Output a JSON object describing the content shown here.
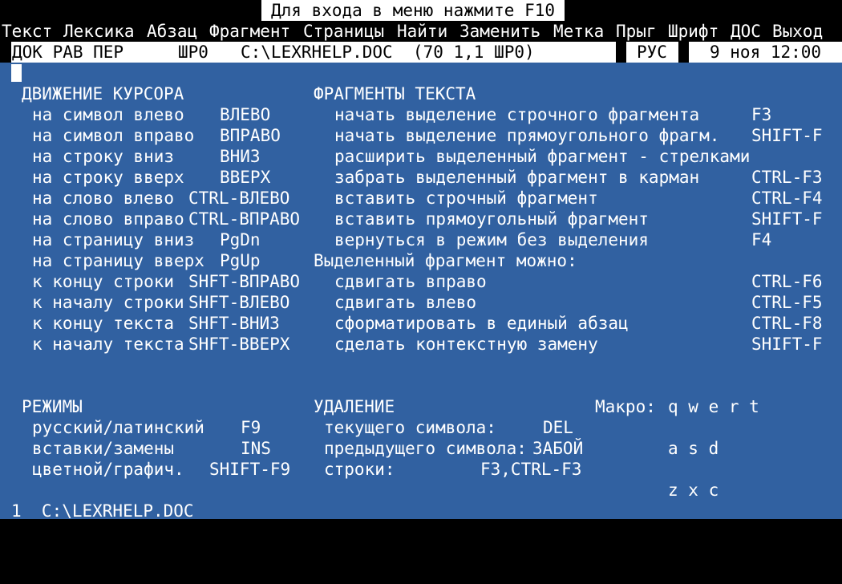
{
  "top_hint": {
    "text": "Для входа в меню нажмите F10"
  },
  "menu": [
    "Текст",
    "Лексика",
    "Абзац",
    "Фрагмент",
    "Страницы",
    "Найти",
    "Заменить",
    "Метка",
    "Прыг",
    "Шрифт",
    "ДОС",
    "Выход"
  ],
  "status": {
    "modes": "ДОК РАВ ПЕР",
    "width_mode": "ШР0",
    "file_info": "C:\\LEXRHELP.DOC  (70 1,1 ШР0)",
    "lang": "РУС",
    "datetime": "9 ноя 12:00"
  },
  "colors": {
    "document_bg": "#3161a1",
    "bar_bg": "#000000",
    "status_bg": "#ffffff"
  },
  "cursor_section": {
    "title": "ДВИЖЕНИЕ КУРСОРА",
    "items": [
      {
        "action": "на символ влево",
        "key": "ВЛЕВО"
      },
      {
        "action": "на символ вправо",
        "key": "ВПРАВО"
      },
      {
        "action": "на строку вниз",
        "key": "ВНИЗ"
      },
      {
        "action": "на строку вверх",
        "key": "ВВЕРХ"
      },
      {
        "action": "на слово влево",
        "key": "CTRL-ВЛЕВО"
      },
      {
        "action": "на слово вправо",
        "key": "CTRL-ВПРАВО"
      },
      {
        "action": "на страницу вниз",
        "key": "PgDn"
      },
      {
        "action": "на страницу вверх",
        "key": "PgUp"
      },
      {
        "action": "к концу строки",
        "key": "SHFT-ВПРАВО"
      },
      {
        "action": "к началу строки",
        "key": "SHFT-ВЛЕВО"
      },
      {
        "action": "к концу текста",
        "key": "SHFT-ВНИЗ"
      },
      {
        "action": "к началу текста",
        "key": "SHFT-ВВЕРХ"
      }
    ]
  },
  "fragments_section": {
    "title": "ФРАГМЕНТЫ ТЕКСТА",
    "subtitle": "Выделенный фрагмент можно:",
    "items": [
      {
        "action": "начать выделение строчного фрагмента",
        "key": "F3"
      },
      {
        "action": "начать выделение прямоугольного фрагм.",
        "key": "SHIFT-F"
      },
      {
        "action": "расширить выделенный фрагмент - стрелками",
        "key": ""
      },
      {
        "action": "забрать выделенный фрагмент в карман",
        "key": "CTRL-F3"
      },
      {
        "action": "вставить строчный фрагмент",
        "key": "CTRL-F4"
      },
      {
        "action": "вставить прямоугольный фрагмент",
        "key": "SHIFT-F"
      },
      {
        "action": "вернуться в режим без выделения",
        "key": "F4"
      },
      {
        "action": "сдвигать вправо",
        "key": "CTRL-F6"
      },
      {
        "action": "сдвигать влево",
        "key": "CTRL-F5"
      },
      {
        "action": "сформатировать в единый абзац",
        "key": "CTRL-F8"
      },
      {
        "action": "сделать контекстную замену",
        "key": "SHIFT-F"
      }
    ]
  },
  "modes_section": {
    "title": "РЕЖИМЫ",
    "items": [
      {
        "action": "русский/латинский",
        "key": "F9"
      },
      {
        "action": "вставки/замены",
        "key": "INS"
      },
      {
        "action": "цветной/графич.",
        "key": "SHIFT-F9"
      }
    ]
  },
  "delete_section": {
    "title": "УДАЛЕНИЕ",
    "items": [
      {
        "action": "текущего символа:",
        "key": "DEL"
      },
      {
        "action": "предыдущего символа:",
        "key": "ЗАБОЙ"
      },
      {
        "action": "строки:",
        "key": "F3,CTRL-F3"
      }
    ]
  },
  "macro_section": {
    "label": "Макро:",
    "rows": [
      "q w e r t",
      "a s d",
      "z x c"
    ]
  },
  "footer": {
    "text": "1  C:\\LEXRHELP.DOC"
  }
}
